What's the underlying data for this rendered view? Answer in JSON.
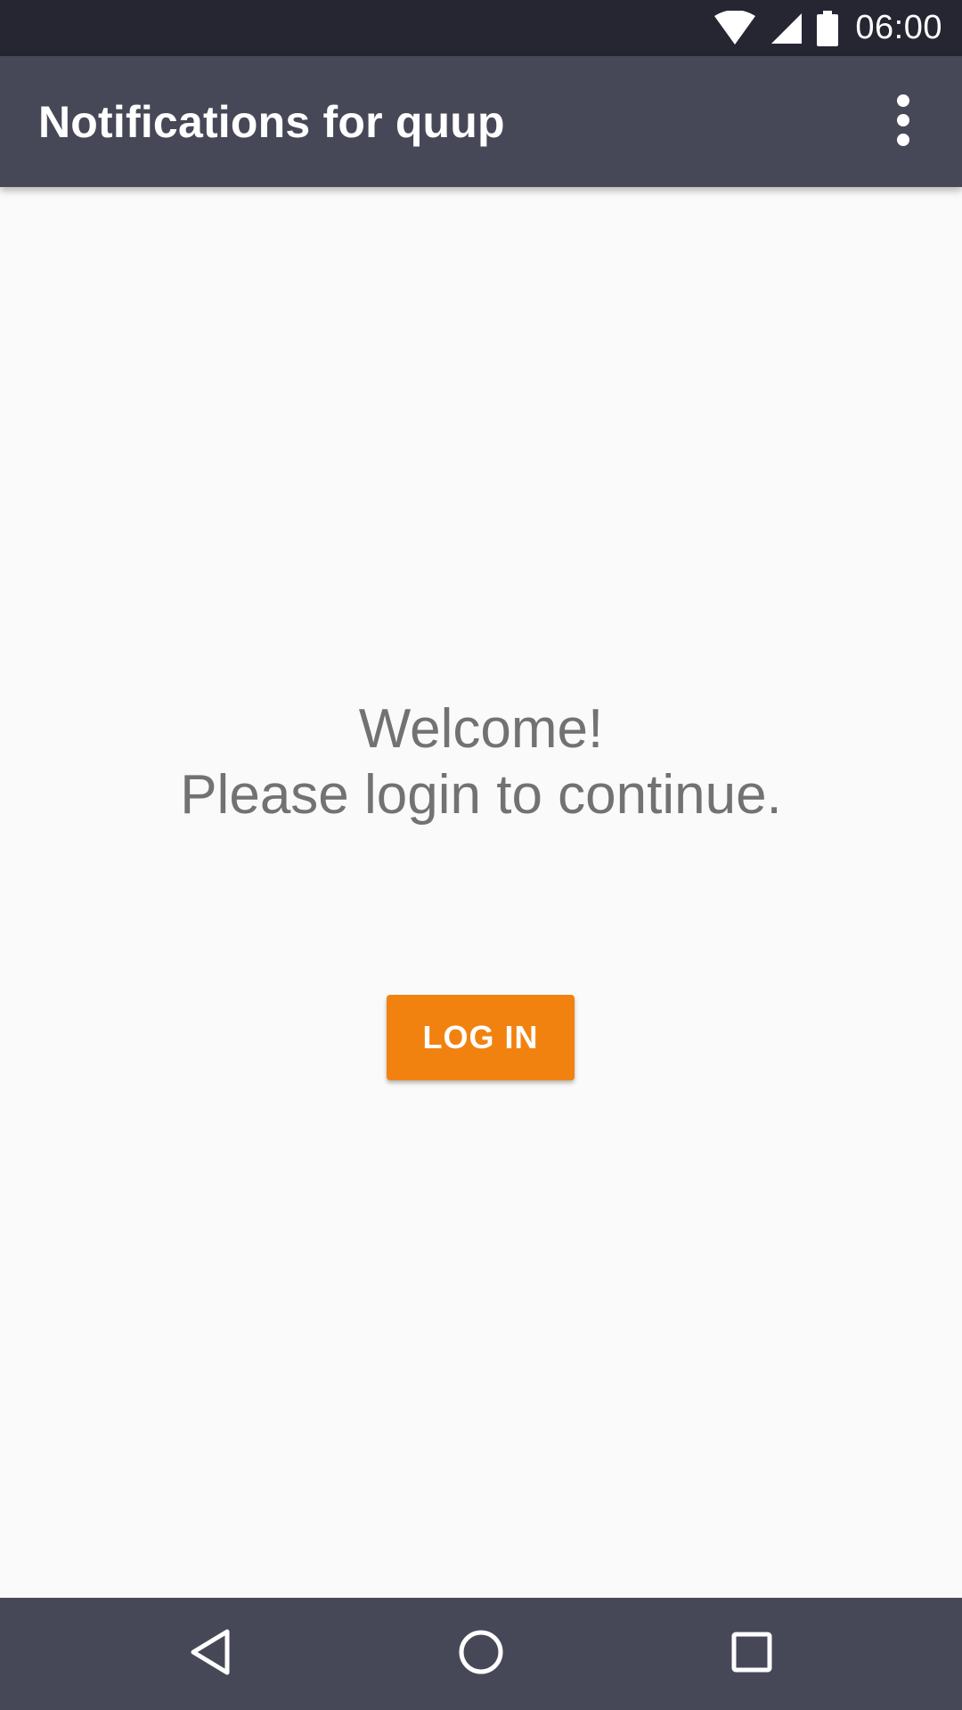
{
  "status_bar": {
    "time": "06:00",
    "icons": [
      "wifi-icon",
      "cellular-signal-icon",
      "battery-icon"
    ]
  },
  "app_bar": {
    "title": "Notifications for quup",
    "overflow_icon": "more-vert-icon"
  },
  "main": {
    "welcome_line1": "Welcome!",
    "welcome_line2": "Please login to continue.",
    "login_button_label": "LOG IN"
  },
  "nav_bar": {
    "icons": [
      "back-icon",
      "home-icon",
      "recents-icon"
    ]
  },
  "colors": {
    "status_bar": "#262633",
    "app_bar": "#474857",
    "background": "#FAFAFA",
    "text_secondary": "#727272",
    "accent": "#F2820F",
    "nav_bar": "#474857"
  }
}
